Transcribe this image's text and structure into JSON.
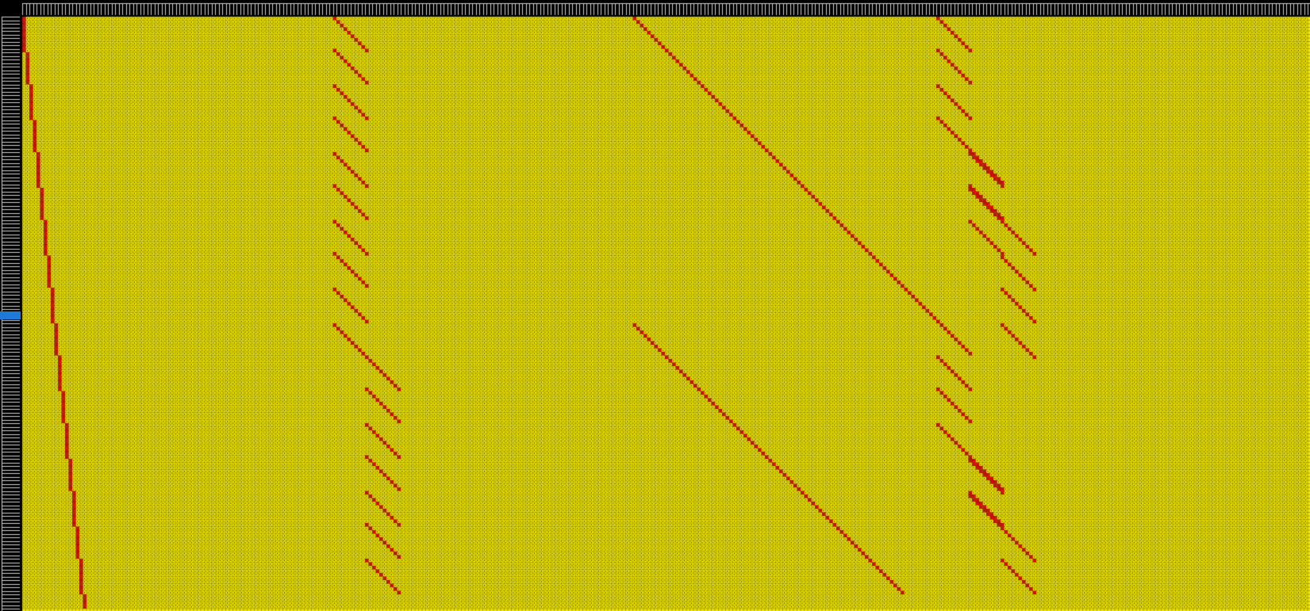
{
  "sheet": {
    "column_header_text": "",
    "row_header_text": "",
    "cell_glyph": "4",
    "colors": {
      "background": "#000000",
      "grid_line": "#000000",
      "cell_fill": "#f2e800",
      "cell_text": "#3a3a00",
      "highlight_fill": "#e61010",
      "header_fill": "#000000",
      "header_text": "#d0d0d0",
      "selected_row": "#1e7ad6"
    }
  }
}
